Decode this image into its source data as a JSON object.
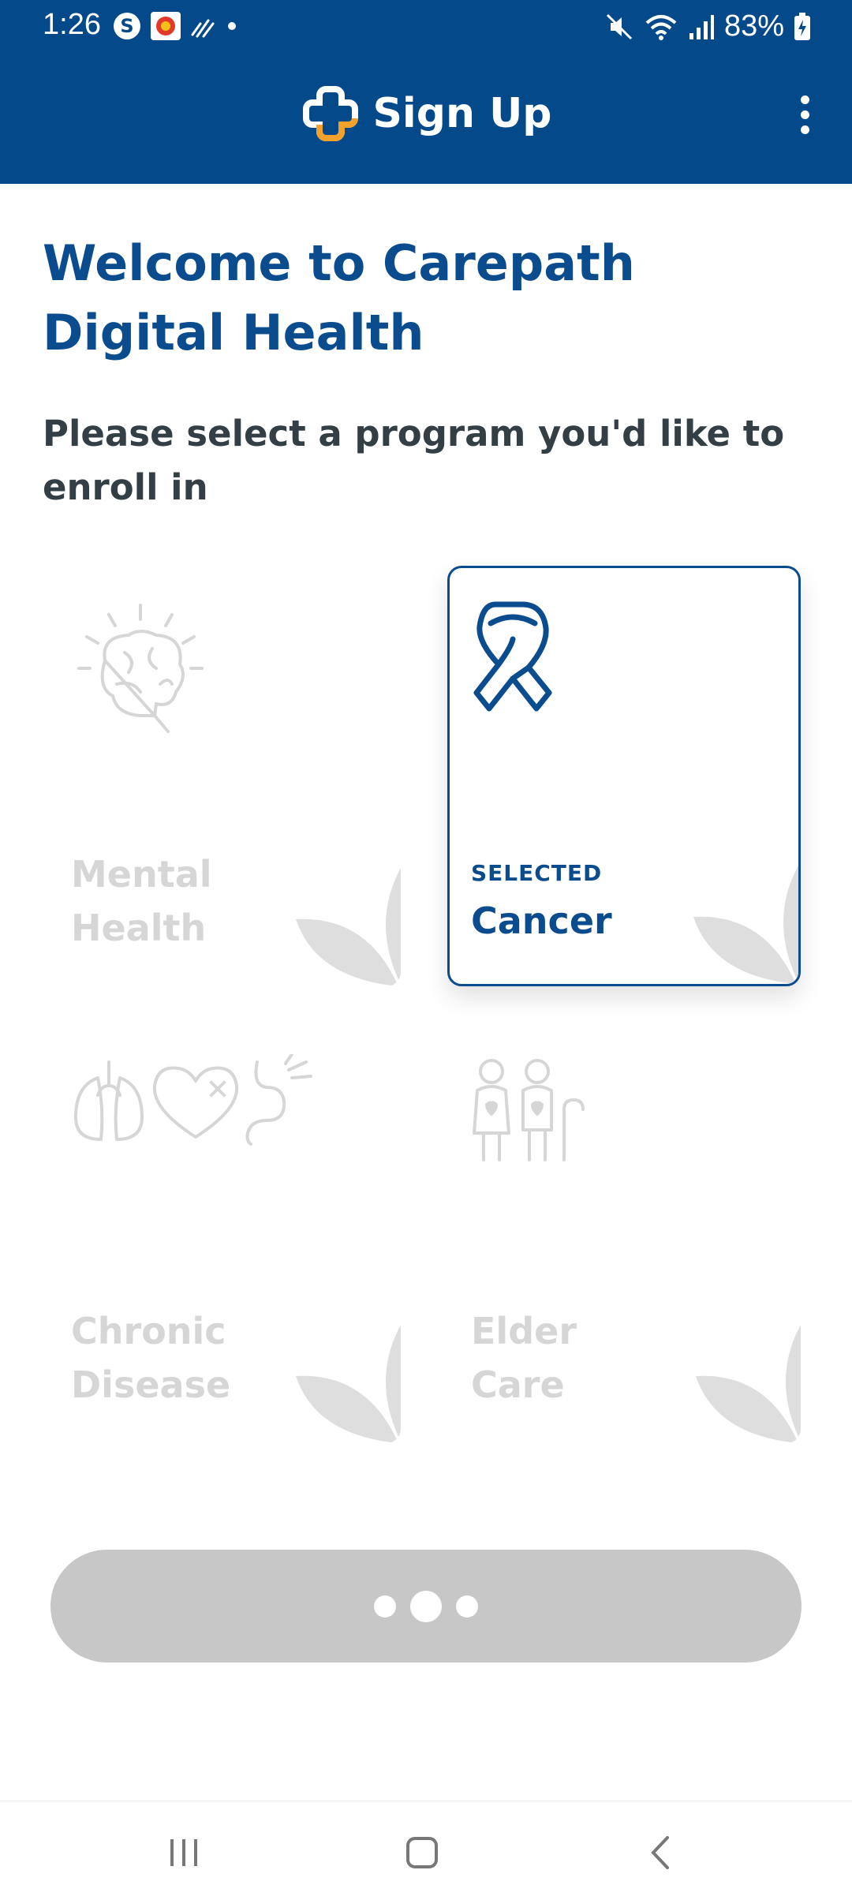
{
  "status_bar": {
    "time": "1:26",
    "battery": "83%",
    "icons": [
      "skype-icon",
      "app-notification-icon",
      "signal-activity-icon",
      "dot-icon",
      "mute-icon",
      "wifi-icon",
      "cellular-signal-icon",
      "battery-charging-icon"
    ]
  },
  "app_bar": {
    "title": "Sign Up",
    "logo": "carepath-cross-logo",
    "menu_icon": "more-vert-icon",
    "background": "#04498A"
  },
  "welcome": {
    "title": "Welcome to Carepath Digital Health",
    "subtitle": "Please select a program you'd like to enroll in"
  },
  "programs": [
    {
      "label": "Mental Health",
      "icon": "brain-icon",
      "selected": false
    },
    {
      "label": "Cancer",
      "icon": "ribbon-icon",
      "selected": true,
      "badge": "SELECTED"
    },
    {
      "label": "Chronic Disease",
      "icon": "organs-icon",
      "selected": false
    },
    {
      "label": "Elder Care",
      "icon": "elderly-couple-icon",
      "selected": false
    }
  ],
  "continue_button": {
    "state": "loading",
    "icon": "loading-dots-icon"
  },
  "nav_bar": {
    "icons": [
      "recent-apps-icon",
      "home-icon",
      "back-icon"
    ]
  },
  "colors": {
    "primary": "#0A4C8E",
    "accent": "#F2A22B",
    "inactive": "#D6D6D6",
    "button_disabled": "#C7C7C7"
  }
}
